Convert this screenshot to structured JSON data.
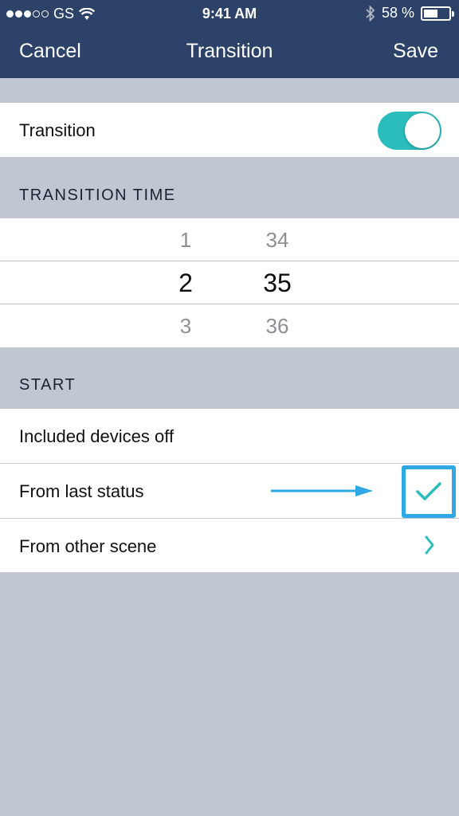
{
  "status_bar": {
    "carrier": "GS",
    "time": "9:41 AM",
    "battery_percent": "58 %",
    "battery_level": 0.58,
    "icons": [
      "signal-dots-icon",
      "wifi-icon",
      "bluetooth-icon",
      "battery-icon"
    ]
  },
  "nav": {
    "cancel_label": "Cancel",
    "title": "Transition",
    "save_label": "Save"
  },
  "transition_row": {
    "label": "Transition",
    "toggle_on": true
  },
  "transition_time": {
    "header": "TRANSITION TIME",
    "left_column": {
      "above": "1",
      "selected": "2",
      "below": "3"
    },
    "right_column": {
      "above": "34",
      "selected": "35",
      "below": "36"
    }
  },
  "start": {
    "header": "START",
    "options": [
      {
        "label": "Included devices off"
      },
      {
        "label": "From last status",
        "checked": true
      },
      {
        "label": "From other scene",
        "icon": "chevron-right-icon"
      }
    ]
  },
  "colors": {
    "nav_background": "#2c4268",
    "accent": "#2bbcbc",
    "highlight_box": "#30a8e6",
    "group_background": "#c0c7d1"
  }
}
